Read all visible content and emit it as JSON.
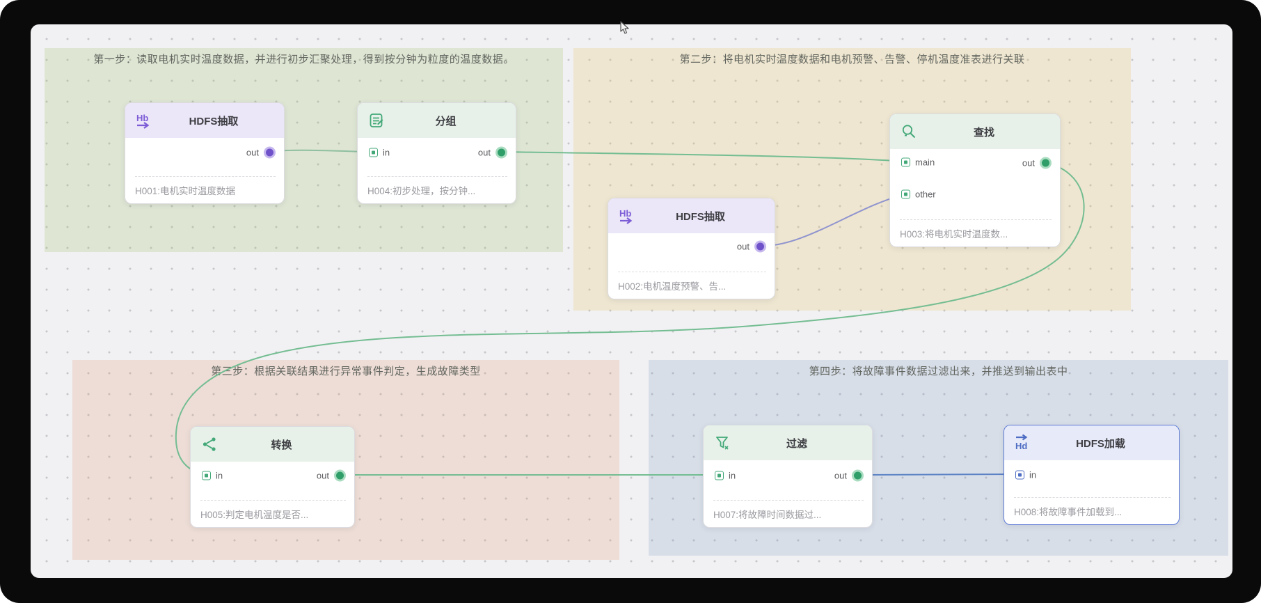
{
  "regions": {
    "step1": {
      "title": "第一步：读取电机实时温度数据，并进行初步汇聚处理，得到按分钟为粒度的温度数据。",
      "color": "#e4ecda"
    },
    "step2": {
      "title": "第二步：将电机实时温度数据和电机预警、告警、停机温度准表进行关联",
      "color": "#f6efd9"
    },
    "step3": {
      "title": "第三步：根据关联结果进行异常事件判定，生成故障类型",
      "color": "#f1e2d8"
    },
    "step4": {
      "title": "第四步：将故障事件数据过滤出来，并推送到输出表中",
      "color": "#dbe2ea"
    }
  },
  "nodes": {
    "h001": {
      "title": "HDFS抽取",
      "desc": "H001:电机实时温度数据",
      "ports": {
        "out": "out"
      }
    },
    "h004": {
      "title": "分组",
      "desc": "H004:初步处理，按分钟...",
      "ports": {
        "in": "in",
        "out": "out"
      }
    },
    "h002": {
      "title": "HDFS抽取",
      "desc": "H002:电机温度预警、告...",
      "ports": {
        "out": "out"
      }
    },
    "h003": {
      "title": "查找",
      "desc": "H003:将电机实时温度数...",
      "ports": {
        "main": "main",
        "other": "other",
        "out": "out"
      }
    },
    "h005": {
      "title": "转换",
      "desc": "H005:判定电机温度是否...",
      "ports": {
        "in": "in",
        "out": "out"
      }
    },
    "h007": {
      "title": "过滤",
      "desc": "H007:将故障时间数据过...",
      "ports": {
        "in": "in",
        "out": "out"
      }
    },
    "h008": {
      "title": "HDFS加载",
      "desc": "H008:将故障事件加载到...",
      "ports": {
        "in": "in"
      }
    }
  },
  "edges": [
    {
      "from": "h001.out",
      "to": "h004.in"
    },
    {
      "from": "h004.out",
      "to": "h003.main"
    },
    {
      "from": "h002.out",
      "to": "h003.other"
    },
    {
      "from": "h003.out",
      "to": "h005.in"
    },
    {
      "from": "h005.out",
      "to": "h007.in"
    },
    {
      "from": "h007.out",
      "to": "h008.in"
    }
  ],
  "colors": {
    "edge_green": "#74bd92",
    "edge_soft_green": "#8fbfa0",
    "edge_purple": "#9094cf",
    "edge_blue": "#5c82c4",
    "purple_accent": "#7c5cd6",
    "green_accent": "#43a878",
    "blue_accent": "#4d6cc3"
  }
}
